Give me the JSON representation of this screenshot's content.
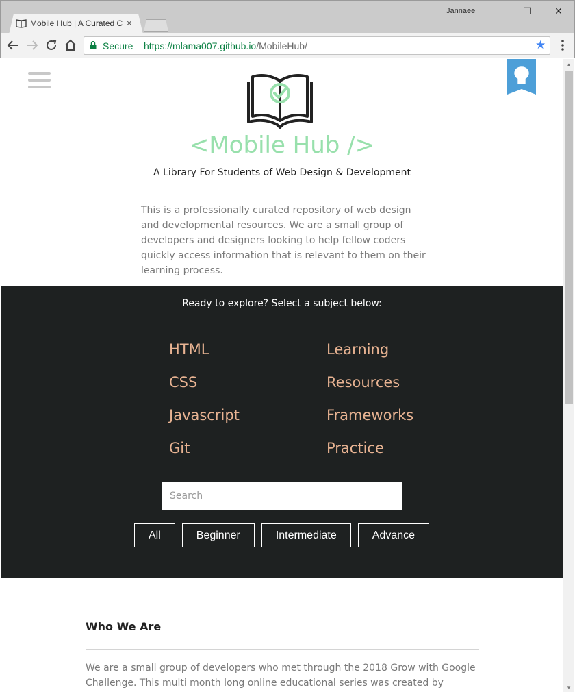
{
  "browser": {
    "tab_title": "Mobile Hub | A Curated C",
    "tab_close": "×",
    "user_name": "Jannaee",
    "window_controls": {
      "minimize": "—",
      "maximize": "☐",
      "close": "✕"
    },
    "security_label": "Secure",
    "url_scheme": "https://",
    "url_domain": "mlama007.github.io",
    "url_path": "/MobileHub/",
    "bookmark_icon": "★"
  },
  "page": {
    "site_title": "<Mobile Hub />",
    "tagline": "A Library For Students of Web Design & Development",
    "intro": "This is a professionally curated repository of web design and developmental resources. We are a small group of developers and designers looking to help fellow coders quickly access information that is relevant to them on their learning process.",
    "explore": {
      "prompt": "Ready to explore? Select a subject below:",
      "subjects": [
        "HTML",
        "Learning",
        "CSS",
        "Resources",
        "Javascript",
        "Frameworks",
        "Git",
        "Practice"
      ],
      "search_placeholder": "Search",
      "levels": [
        "All",
        "Beginner",
        "Intermediate",
        "Advance"
      ]
    },
    "about": {
      "heading": "Who We Are",
      "text": "We are a small group of developers who met through the 2018 Grow with Google Challenge. This multi month long online educational series was created by Udacity and"
    }
  },
  "colors": {
    "title_green": "#98e0ac",
    "subject_orange": "#e8b392",
    "dark_band": "#1e2121",
    "github_blue": "#4d9fd8"
  }
}
